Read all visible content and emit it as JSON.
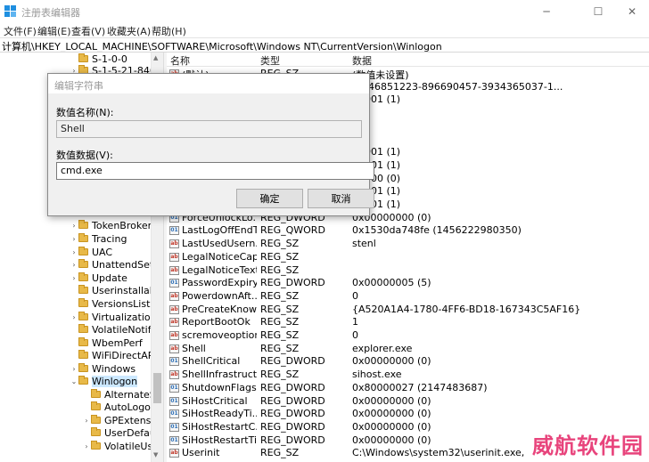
{
  "window": {
    "title": "注册表编辑器",
    "minimize": "─",
    "maximize": "☐",
    "close": "✕"
  },
  "menu": [
    "文件(F)",
    "编辑(E)",
    "查看(V)",
    "收藏夹(A)",
    "帮助(H)"
  ],
  "address": "计算机\\HKEY_LOCAL_MACHINE\\SOFTWARE\\Microsoft\\Windows NT\\CurrentVersion\\Winlogon",
  "tree": [
    {
      "label": "S-1-0-0",
      "expander": "",
      "indent": 0
    },
    {
      "label": "S-1-5-21-846",
      "expander": "›",
      "indent": 0
    },
    {
      "label": "TokenBroker",
      "expander": "›",
      "indent": 0
    },
    {
      "label": "Tracing",
      "expander": "›",
      "indent": 0
    },
    {
      "label": "UAC",
      "expander": "›",
      "indent": 0
    },
    {
      "label": "UnattendSet",
      "expander": "›",
      "indent": 0
    },
    {
      "label": "Update",
      "expander": "›",
      "indent": 0
    },
    {
      "label": "Userinstallab",
      "expander": "",
      "indent": 0
    },
    {
      "label": "VersionsList",
      "expander": "",
      "indent": 0
    },
    {
      "label": "Virtualization",
      "expander": "›",
      "indent": 0
    },
    {
      "label": "VolatileNotifi",
      "expander": "",
      "indent": 0
    },
    {
      "label": "WbemPerf",
      "expander": "",
      "indent": 0
    },
    {
      "label": "WiFiDirectAP",
      "expander": "",
      "indent": 0
    },
    {
      "label": "Windows",
      "expander": "›",
      "indent": 0
    },
    {
      "label": "Winlogon",
      "expander": "⌄",
      "indent": 0,
      "selected": true
    },
    {
      "label": "AlternateS",
      "expander": "",
      "indent": 1
    },
    {
      "label": "AutoLogor",
      "expander": "",
      "indent": 1
    },
    {
      "label": "GPExtensio",
      "expander": "›",
      "indent": 1
    },
    {
      "label": "UserDefau",
      "expander": "",
      "indent": 1
    },
    {
      "label": "VolatileUs",
      "expander": "›",
      "indent": 1
    }
  ],
  "columns": {
    "name": "名称",
    "type": "类型",
    "data": "数据"
  },
  "rows": [
    {
      "name": "(默认)",
      "type": "REG_SZ",
      "data": "(数值未设置)",
      "icon": "ab"
    },
    {
      "name": "",
      "type": "",
      "data": "1-846851223-896690457-3934365037-1...",
      "icon": ""
    },
    {
      "name": "",
      "type": "",
      "data": "00001 (1)",
      "icon": ""
    },
    {
      "name": "",
      "type": "",
      "data": "",
      "icon": ""
    },
    {
      "name": "",
      "type": "",
      "data": "",
      "icon": ""
    },
    {
      "name": "",
      "type": "",
      "data": "",
      "icon": ""
    },
    {
      "name": "",
      "type": "",
      "data": "00001 (1)",
      "icon": ""
    },
    {
      "name": "",
      "type": "",
      "data": "00001 (1)",
      "icon": ""
    },
    {
      "name": "",
      "type": "",
      "data": "00000 (0)",
      "icon": ""
    },
    {
      "name": "",
      "type": "",
      "data": "00001 (1)",
      "icon": ""
    },
    {
      "name": "",
      "type": "",
      "data": "00001 (1)",
      "icon": ""
    },
    {
      "name": "ForceUnlockLo...",
      "type": "REG_DWORD",
      "data": "0x00000000 (0)",
      "icon": "bin"
    },
    {
      "name": "LastLogOffEndT...",
      "type": "REG_QWORD",
      "data": "0x1530da748fe (1456222980350)",
      "icon": "bin"
    },
    {
      "name": "LastUsedUsern...",
      "type": "REG_SZ",
      "data": "stenl",
      "icon": "ab"
    },
    {
      "name": "LegalNoticeCap...",
      "type": "REG_SZ",
      "data": "",
      "icon": "ab"
    },
    {
      "name": "LegalNoticeText",
      "type": "REG_SZ",
      "data": "",
      "icon": "ab"
    },
    {
      "name": "PasswordExpiry...",
      "type": "REG_DWORD",
      "data": "0x00000005 (5)",
      "icon": "bin"
    },
    {
      "name": "PowerdownAft...",
      "type": "REG_SZ",
      "data": "0",
      "icon": "ab"
    },
    {
      "name": "PreCreateKnow...",
      "type": "REG_SZ",
      "data": "{A520A1A4-1780-4FF6-BD18-167343C5AF16}",
      "icon": "ab"
    },
    {
      "name": "ReportBootOk",
      "type": "REG_SZ",
      "data": "1",
      "icon": "ab"
    },
    {
      "name": "scremoveoption",
      "type": "REG_SZ",
      "data": "0",
      "icon": "ab"
    },
    {
      "name": "Shell",
      "type": "REG_SZ",
      "data": "explorer.exe",
      "icon": "ab"
    },
    {
      "name": "ShellCritical",
      "type": "REG_DWORD",
      "data": "0x00000000 (0)",
      "icon": "bin"
    },
    {
      "name": "ShellInfrastruct...",
      "type": "REG_SZ",
      "data": "sihost.exe",
      "icon": "ab"
    },
    {
      "name": "ShutdownFlags",
      "type": "REG_DWORD",
      "data": "0x80000027 (2147483687)",
      "icon": "bin"
    },
    {
      "name": "SiHostCritical",
      "type": "REG_DWORD",
      "data": "0x00000000 (0)",
      "icon": "bin"
    },
    {
      "name": "SiHostReadyTi...",
      "type": "REG_DWORD",
      "data": "0x00000000 (0)",
      "icon": "bin"
    },
    {
      "name": "SiHostRestartC...",
      "type": "REG_DWORD",
      "data": "0x00000000 (0)",
      "icon": "bin"
    },
    {
      "name": "SiHostRestartTi...",
      "type": "REG_DWORD",
      "data": "0x00000000 (0)",
      "icon": "bin"
    },
    {
      "name": "Userinit",
      "type": "REG_SZ",
      "data": "C:\\Windows\\system32\\userinit.exe,",
      "icon": "ab"
    }
  ],
  "dialog": {
    "title": "编辑字符串",
    "name_label": "数值名称(N):",
    "name_value": "Shell",
    "data_label": "数值数据(V):",
    "data_value": "cmd.exe",
    "ok": "确定",
    "cancel": "取消"
  },
  "watermark": "威航软件园",
  "icon_text": {
    "string": "ab",
    "binary": "01"
  }
}
